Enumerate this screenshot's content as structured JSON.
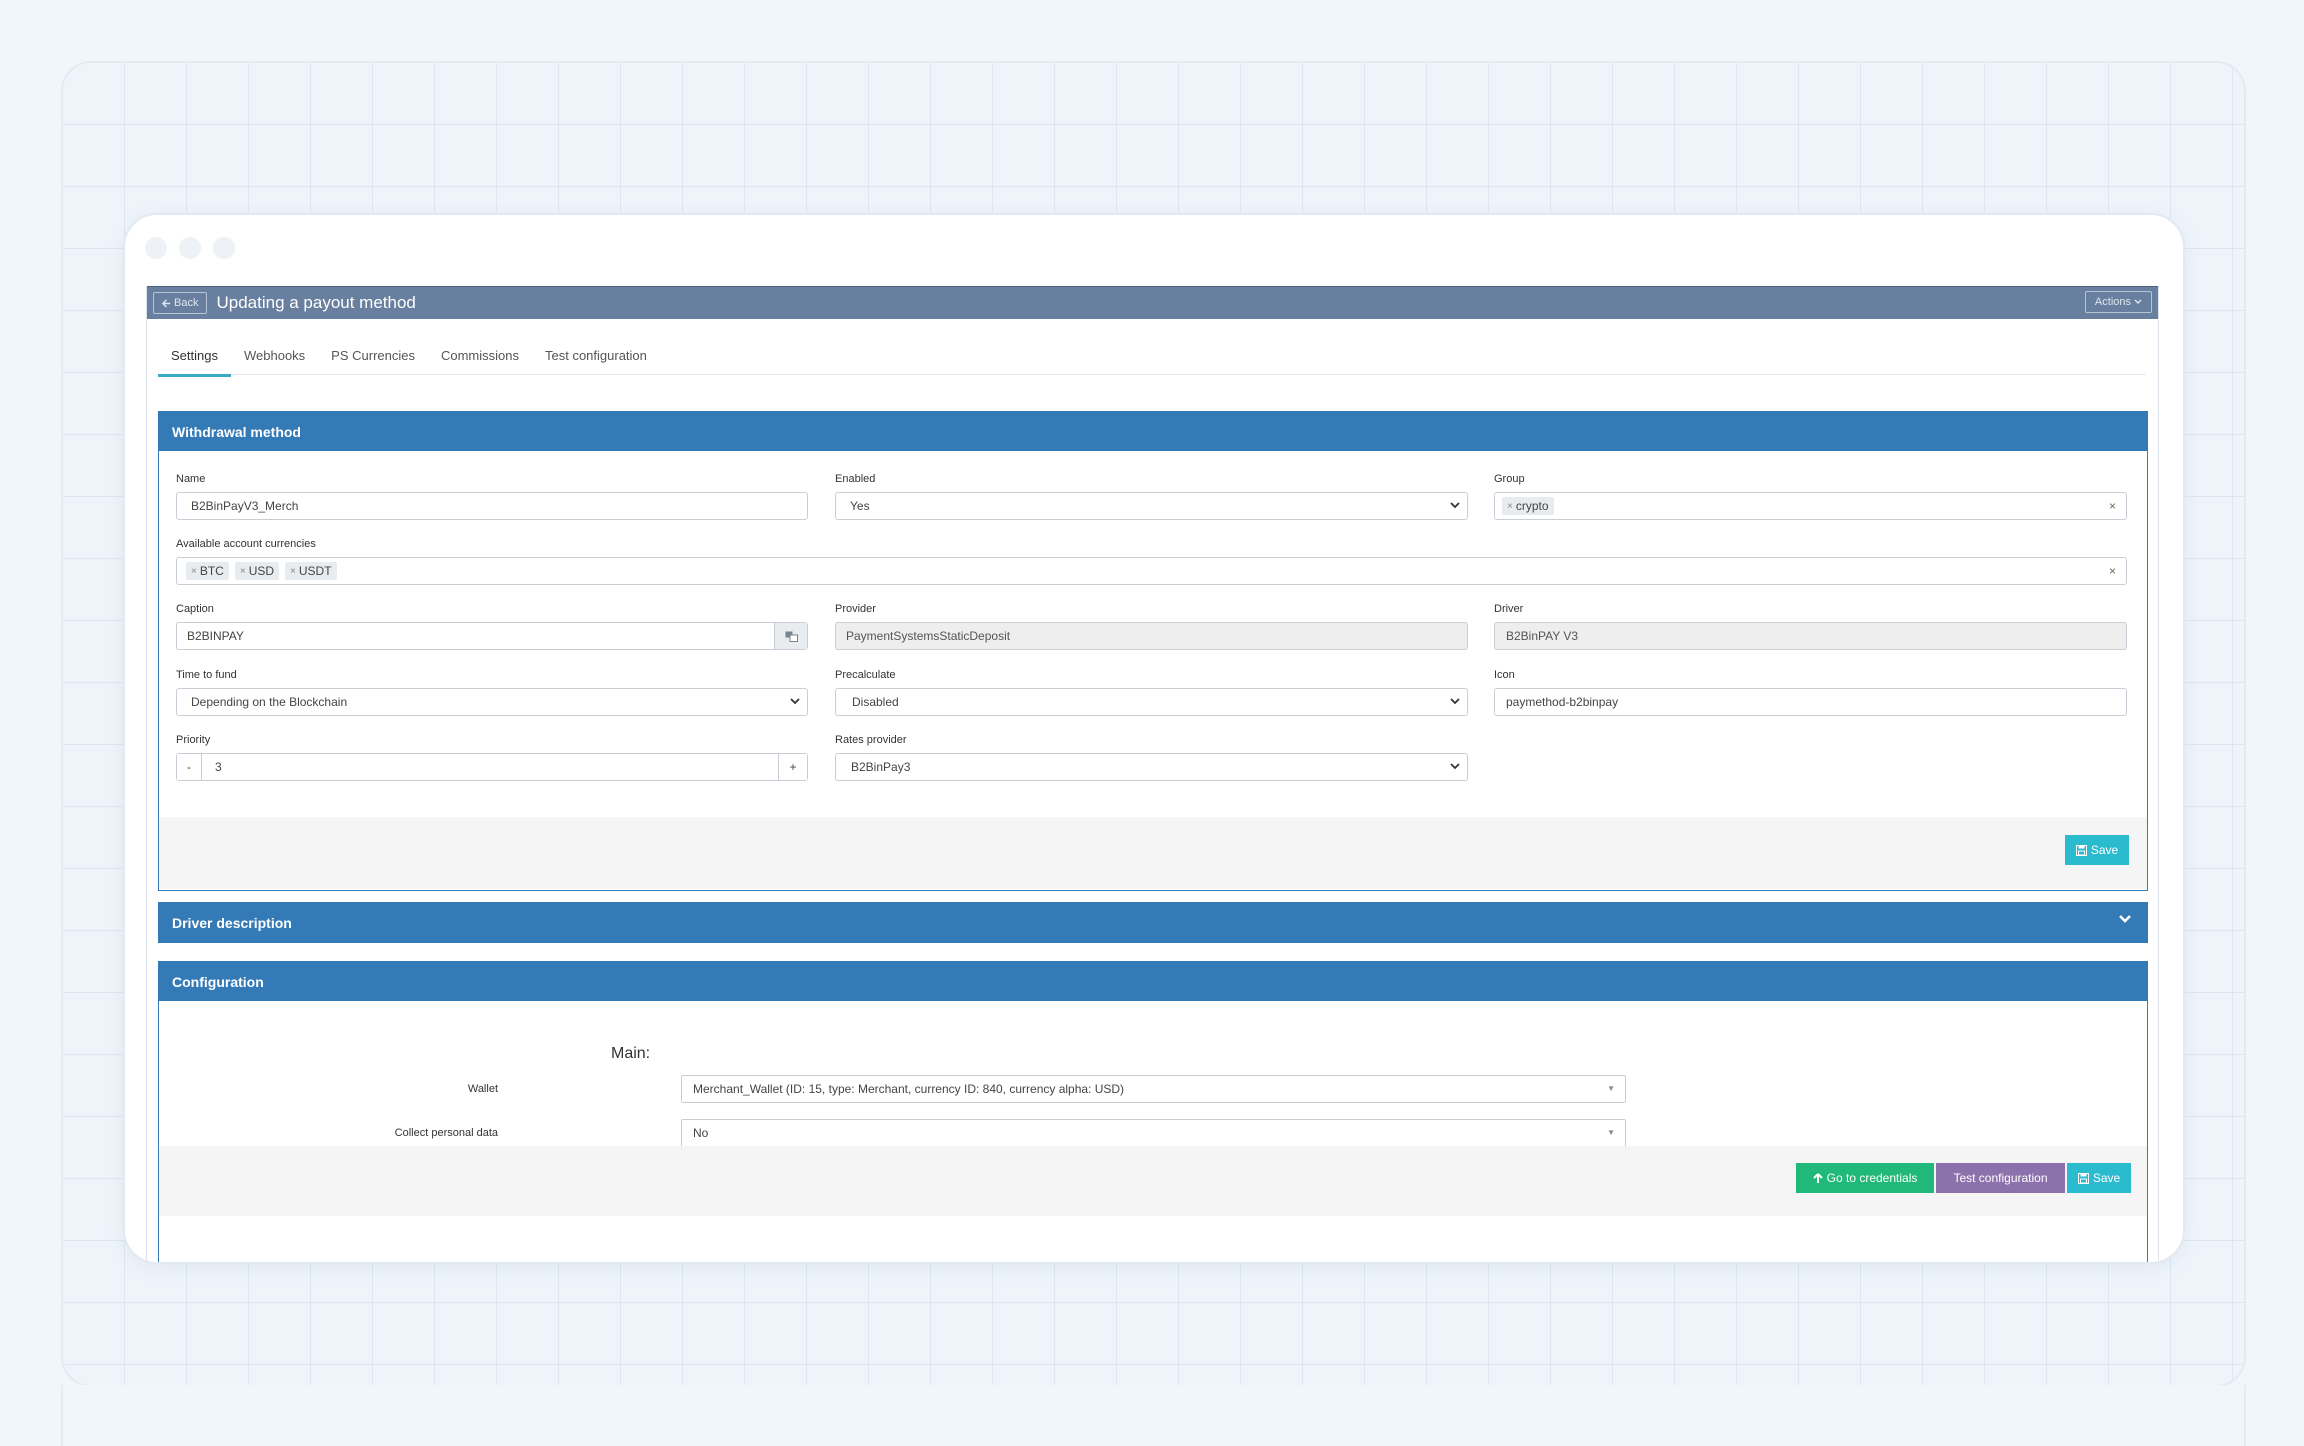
{
  "header": {
    "back_label": "Back",
    "title": "Updating a payout method",
    "actions_label": "Actions"
  },
  "tabs": [
    {
      "label": "Settings",
      "active": true
    },
    {
      "label": "Webhooks"
    },
    {
      "label": "PS Currencies"
    },
    {
      "label": "Commissions"
    },
    {
      "label": "Test configuration"
    }
  ],
  "withdrawal": {
    "title": "Withdrawal method",
    "name": {
      "label": "Name",
      "value": "B2BinPayV3_Merch"
    },
    "enabled": {
      "label": "Enabled",
      "value": "Yes"
    },
    "group": {
      "label": "Group",
      "chips": [
        "crypto"
      ]
    },
    "currencies": {
      "label": "Available account currencies",
      "chips": [
        "BTC",
        "USD",
        "USDT"
      ]
    },
    "caption": {
      "label": "Caption",
      "value": "B2BINPAY"
    },
    "provider": {
      "label": "Provider",
      "value": "PaymentSystemsStaticDeposit"
    },
    "driver": {
      "label": "Driver",
      "value": "B2BinPAY V3"
    },
    "time_to_fund": {
      "label": "Time to fund",
      "value": "Depending on the Blockchain"
    },
    "precalculate": {
      "label": "Precalculate",
      "value": "Disabled"
    },
    "icon": {
      "label": "Icon",
      "value": "paymethod-b2binpay"
    },
    "priority": {
      "label": "Priority",
      "value": "3",
      "minus": "-",
      "plus": "+"
    },
    "rates_provider": {
      "label": "Rates provider",
      "value": "B2BinPay3"
    },
    "save_label": "Save"
  },
  "driver_description": {
    "title": "Driver description"
  },
  "configuration": {
    "title": "Configuration",
    "section_title": "Main:",
    "wallet": {
      "label": "Wallet",
      "value": "Merchant_Wallet (ID: 15, type: Merchant, currency ID: 840, currency alpha: USD)"
    },
    "collect": {
      "label": "Collect personal data",
      "value": "No"
    },
    "credentials_label": "Go to credentials",
    "test_label": "Test configuration",
    "save_label": "Save"
  },
  "colors": {
    "primary": "#337ab7",
    "header": "#687f9f",
    "info": "#2bbbcf",
    "success": "#21b979",
    "purple": "#8c72ac"
  }
}
